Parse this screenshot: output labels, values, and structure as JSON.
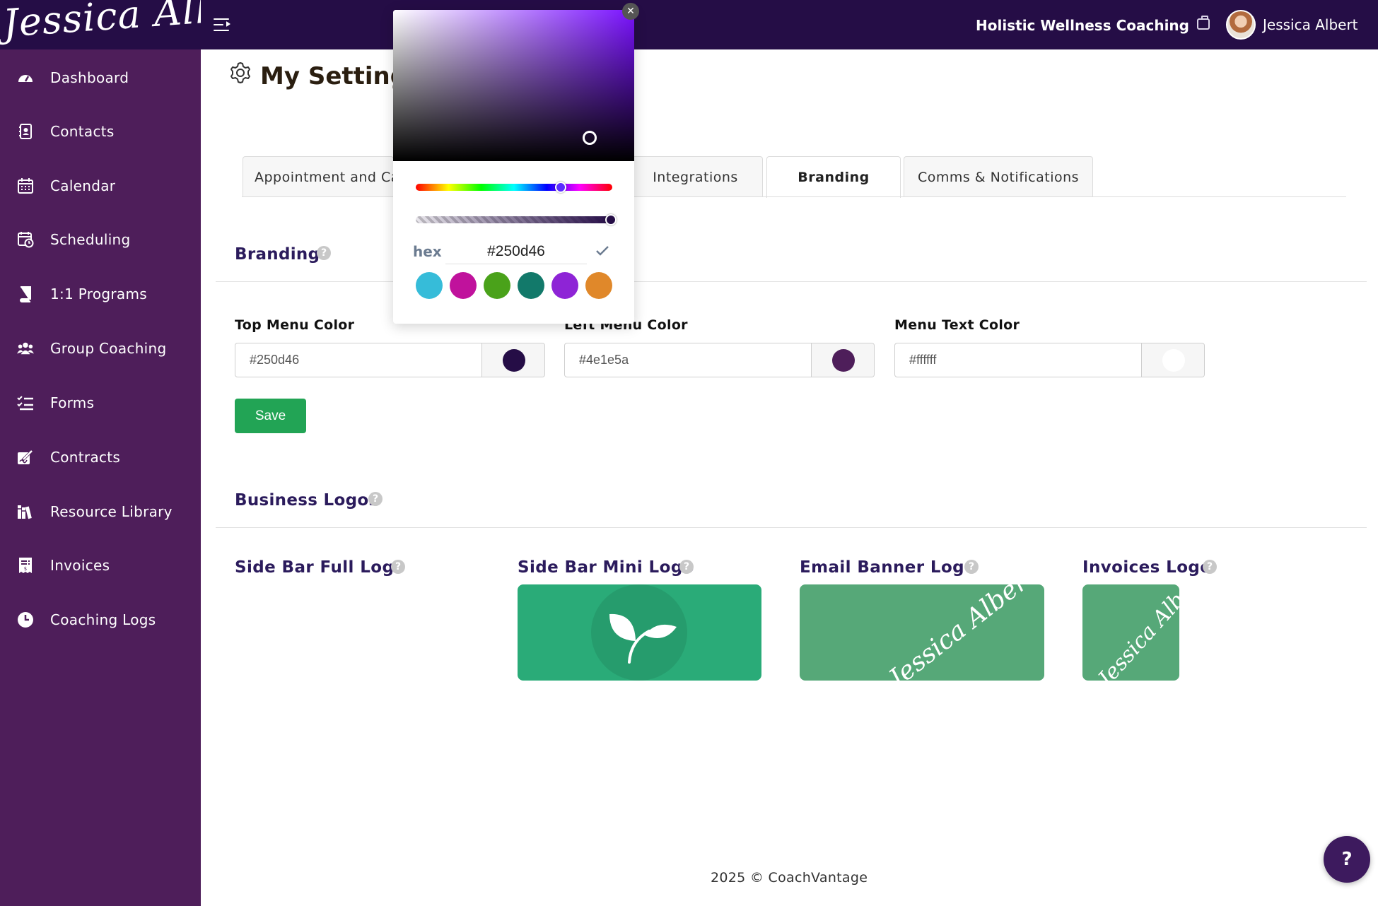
{
  "brand": {
    "logo_text": "Jessica Albert"
  },
  "header": {
    "business_name": "Holistic Wellness Coaching",
    "user_name": "Jessica Albert",
    "bg_color": "#250d46"
  },
  "sidebar": {
    "bg_color": "#4e1e5a",
    "items": [
      {
        "label": "Dashboard",
        "icon": "dashboard-icon"
      },
      {
        "label": "Contacts",
        "icon": "contacts-icon"
      },
      {
        "label": "Calendar",
        "icon": "calendar-icon"
      },
      {
        "label": "Scheduling",
        "icon": "scheduling-icon"
      },
      {
        "label": "1:1 Programs",
        "icon": "book-icon"
      },
      {
        "label": "Group Coaching",
        "icon": "users-icon"
      },
      {
        "label": "Forms",
        "icon": "checklist-icon"
      },
      {
        "label": "Contracts",
        "icon": "signature-icon"
      },
      {
        "label": "Resource Library",
        "icon": "library-icon"
      },
      {
        "label": "Invoices",
        "icon": "invoice-icon"
      },
      {
        "label": "Coaching Logs",
        "icon": "clock-icon"
      }
    ]
  },
  "page": {
    "title": "My Settings"
  },
  "tabs": [
    {
      "label": "Appointment and Calendar",
      "active": false
    },
    {
      "label": "Integrations",
      "active": false
    },
    {
      "label": "Branding",
      "active": true
    },
    {
      "label": "Comms & Notifications",
      "active": false
    }
  ],
  "branding": {
    "section_title": "Branding",
    "fields": [
      {
        "label": "Top Menu Color",
        "value": "#250d46",
        "swatch": "#250d46"
      },
      {
        "label": "Left Menu Color",
        "value": "#4e1e5a",
        "swatch": "#4e1e5a"
      },
      {
        "label": "Menu Text Color",
        "value": "#ffffff",
        "swatch": "#ffffff"
      }
    ],
    "save_label": "Save"
  },
  "logos": {
    "section_title": "Business Logos",
    "items": [
      {
        "label": "Side Bar Full Logo"
      },
      {
        "label": "Side Bar Mini Logo"
      },
      {
        "label": "Email Banner Logo",
        "image_text": "Jessica Albert"
      },
      {
        "label": "Invoices Logo",
        "image_text": "Jessica Albert"
      }
    ]
  },
  "color_picker": {
    "hex_label": "hex",
    "hex_value": "#250d46",
    "presets": [
      "#36bcd9",
      "#c0129c",
      "#4aa21a",
      "#12796a",
      "#8e24d6",
      "#e0882a"
    ],
    "alpha": 1
  },
  "footer": {
    "text": "2025 © CoachVantage"
  },
  "help_fab": {
    "label": "?"
  }
}
